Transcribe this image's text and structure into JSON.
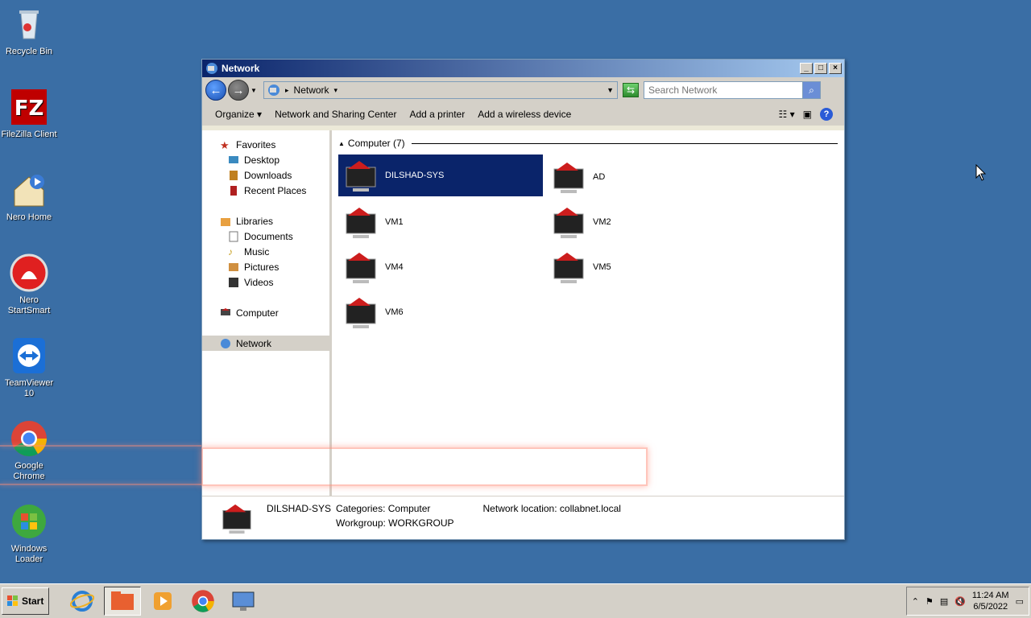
{
  "desktop": {
    "icons": [
      {
        "label": "Recycle Bin",
        "icon": "recycle-bin-icon"
      },
      {
        "label": "FileZilla Client",
        "icon": "filezilla-icon"
      },
      {
        "label": "Nero Home",
        "icon": "nero-home-icon"
      },
      {
        "label": "Nero StartSmart",
        "icon": "nero-startsmart-icon"
      },
      {
        "label": "TeamViewer 10",
        "icon": "teamviewer-icon"
      },
      {
        "label": "Google Chrome",
        "icon": "chrome-icon"
      },
      {
        "label": "Windows Loader",
        "icon": "windows-loader-icon"
      }
    ]
  },
  "window": {
    "title": "Network",
    "address": "Network",
    "search_placeholder": "Search Network",
    "commands": [
      "Organize",
      "Network and Sharing Center",
      "Add a printer",
      "Add a wireless device"
    ],
    "nav": {
      "favorites": "Favorites",
      "desktop": "Desktop",
      "downloads": "Downloads",
      "recent": "Recent Places",
      "libraries": "Libraries",
      "documents": "Documents",
      "music": "Music",
      "pictures": "Pictures",
      "videos": "Videos",
      "computer": "Computer",
      "network": "Network"
    },
    "group": "Computer (7)",
    "items": [
      "DILSHAD-SYS",
      "AD",
      "VM1",
      "VM2",
      "VM4",
      "VM5",
      "VM6"
    ],
    "details": {
      "name": "DILSHAD-SYS",
      "categories": "Categories: Computer",
      "workgroup": "Workgroup: WORKGROUP",
      "location": "Network location: collabnet.local"
    }
  },
  "taskbar": {
    "start": "Start",
    "time": "11:24 AM",
    "date": "6/5/2022"
  },
  "colors": {
    "desktop": "#3a6ea5",
    "selection": "#0a246a"
  }
}
